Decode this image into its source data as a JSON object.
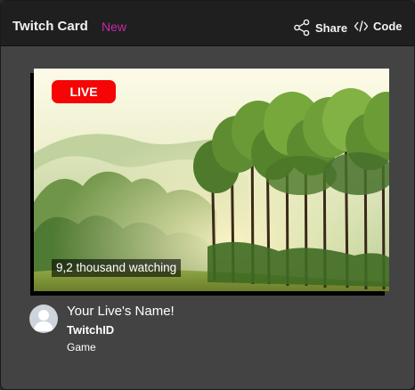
{
  "header": {
    "title": "Twitch Card",
    "badge": "New",
    "share_label": "Share",
    "code_label": "Code"
  },
  "icons": {
    "share": "share-icon",
    "code": "code-icon",
    "avatar": "user-avatar-icon"
  },
  "stream": {
    "live_label": "LIVE",
    "viewers_text": "9,2 thousand watching",
    "title": "Your Live's Name!",
    "channel": "TwitchID",
    "game": "Game"
  },
  "colors": {
    "accent_new": "#c32aa6",
    "live_red": "#f50505",
    "card_bg": "#434343",
    "header_bg": "#1f1f1f"
  }
}
